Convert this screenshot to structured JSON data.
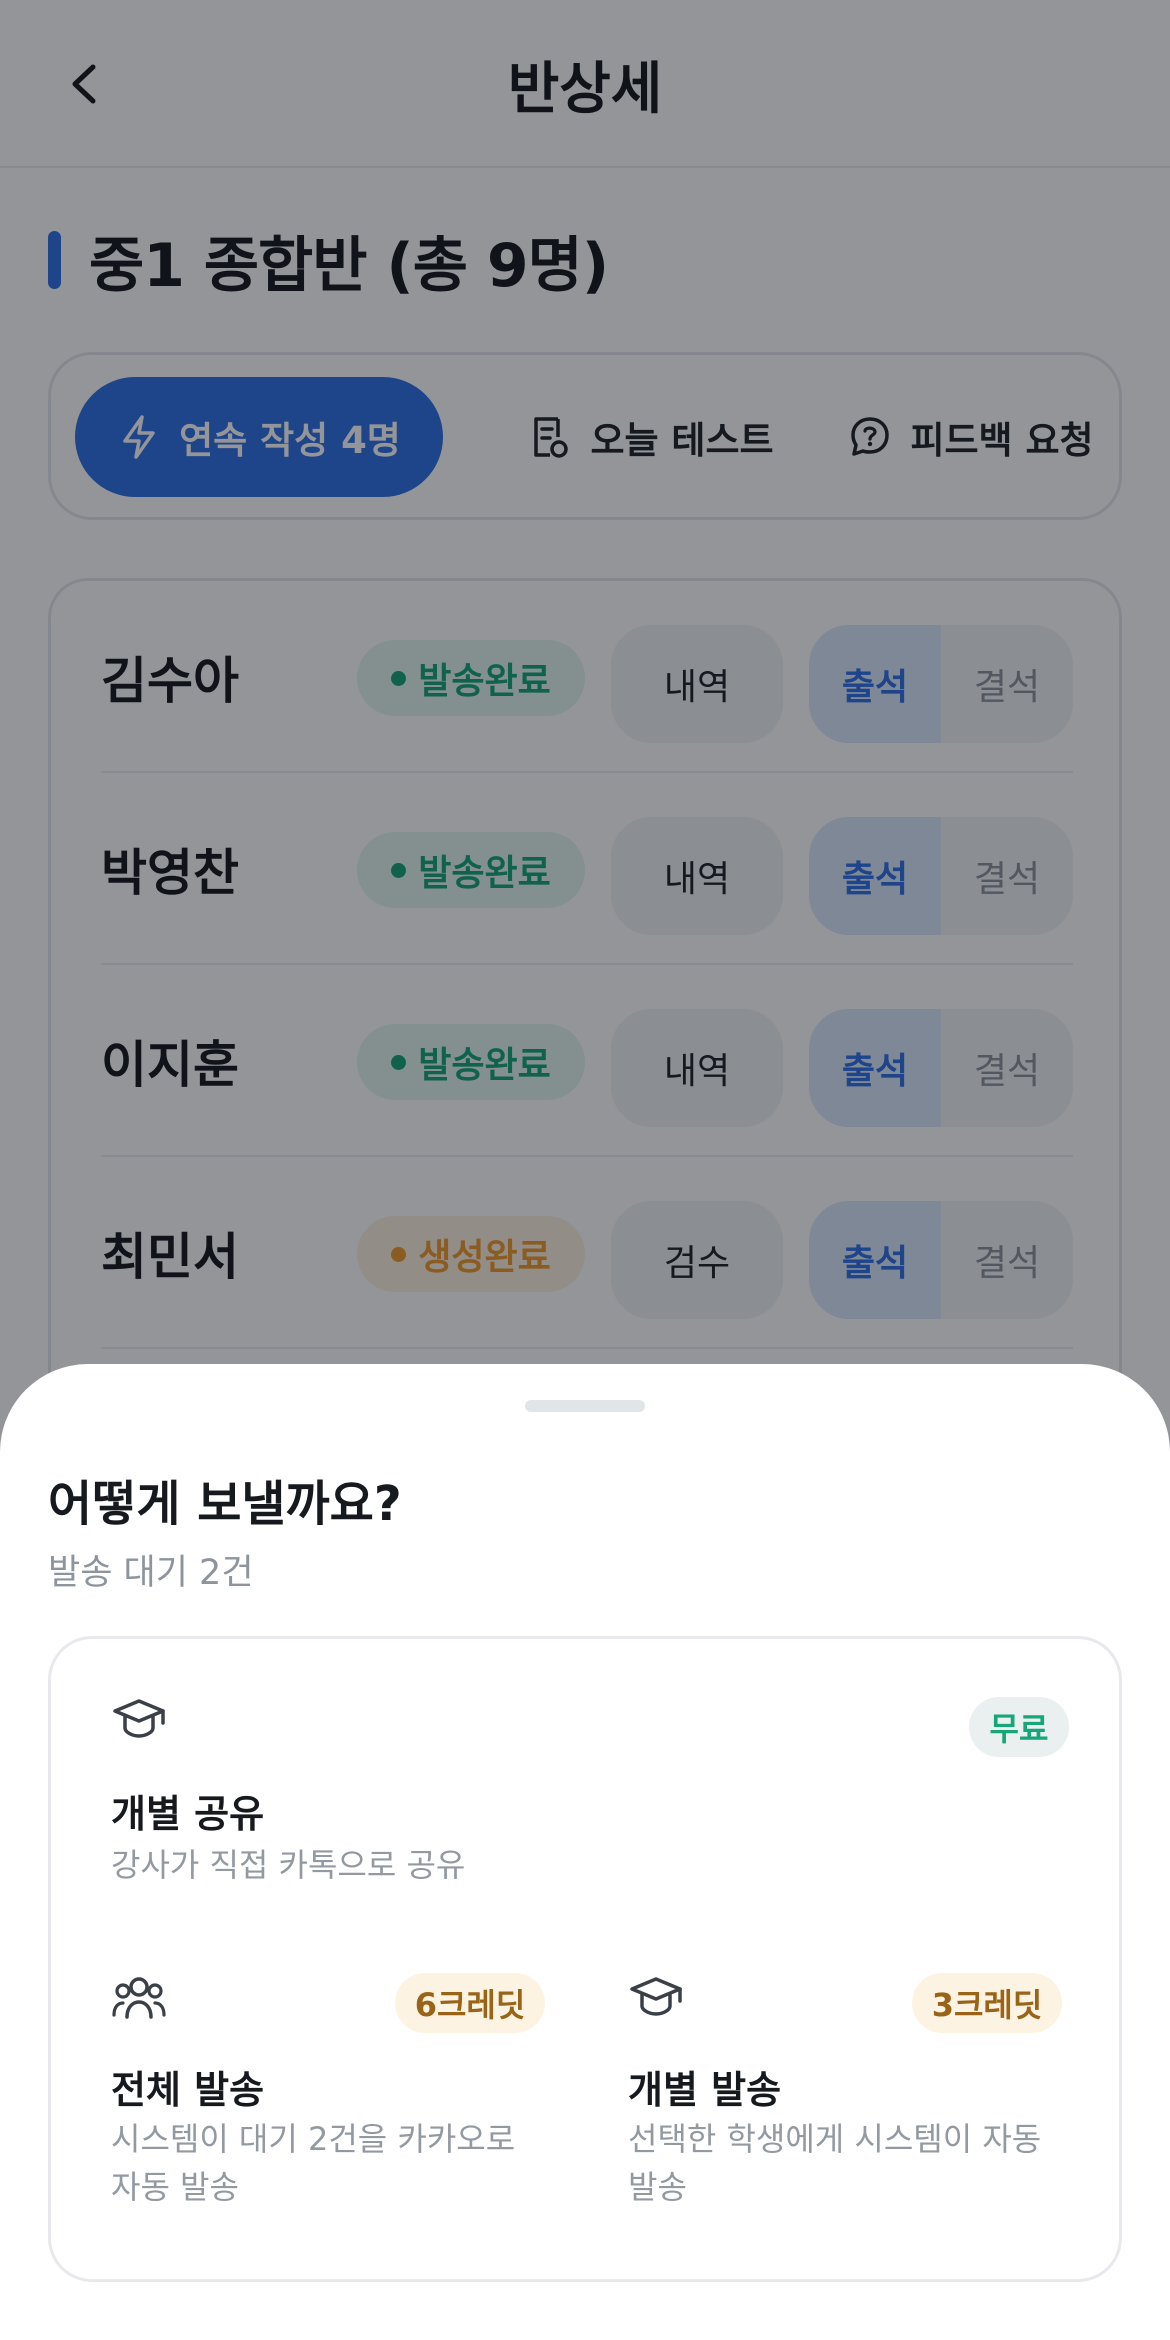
{
  "header": {
    "title": "반상세"
  },
  "class_info": {
    "title": "중1 종합반 (총 9명)"
  },
  "actions": {
    "continuous_write": "연속 작성 4명",
    "today_test": "오늘 테스트",
    "feedback_request": "피드백 요청"
  },
  "students": [
    {
      "name": "김수아",
      "status": "발송완료",
      "action": "내역",
      "present": "출석",
      "absent": "결석"
    },
    {
      "name": "박영찬",
      "status": "발송완료",
      "action": "내역",
      "present": "출석",
      "absent": "결석"
    },
    {
      "name": "이지훈",
      "status": "발송완료",
      "action": "내역",
      "present": "출석",
      "absent": "결석"
    },
    {
      "name": "최민서",
      "status": "생성완료",
      "action": "검수",
      "present": "출석",
      "absent": "결석"
    }
  ],
  "sheet": {
    "title": "어떻게 보낼까요?",
    "subtitle": "발송 대기 2건",
    "options": [
      {
        "icon": "graduation-cap-icon",
        "badge": "무료",
        "title": "개별 공유",
        "desc": "강사가 직접 카톡으로 공유"
      },
      {
        "icon": "users-icon",
        "badge": "6크레딧",
        "title": "전체 발송",
        "desc_line1": "시스템이 대기 2건을 카카오로",
        "desc_line2": "자동 발송"
      },
      {
        "icon": "graduation-cap-icon",
        "badge": "3크레딧",
        "title": "개별 발송",
        "desc_line1": "선택한 학생에게 시스템이 자동",
        "desc_line2": "발송"
      }
    ]
  },
  "colors": {
    "primary": "#2f6fe4",
    "sent_green": "#17a57a",
    "generated_orange": "#ef9a2c",
    "credit_brown": "#9a6418"
  }
}
